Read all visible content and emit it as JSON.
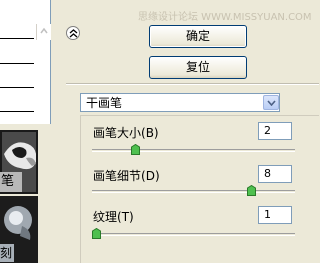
{
  "watermark": "思缘设计论坛 WWW.MISSYUAN.COM",
  "left_panel": {
    "thumb1_label": "笔",
    "thumb2_label": "刻"
  },
  "buttons": {
    "ok": "确定",
    "reset": "复位"
  },
  "filter_select": {
    "value": "干画笔"
  },
  "params": [
    {
      "label": "画笔大小",
      "hotkey": "(B)",
      "value": "2",
      "level": 0.2
    },
    {
      "label": "画笔细节",
      "hotkey": "(D)",
      "value": "8",
      "level": 0.8
    },
    {
      "label": "纹理",
      "hotkey": "(T)",
      "value": "1",
      "level": 0.0
    }
  ],
  "colors": {
    "window_bg": "#ece9d8",
    "input_border": "#7f9db9",
    "button_border": "#003c74",
    "slider_thumb": "#2e9b2e"
  },
  "icons": {
    "collapse": "chevron-double-up-icon",
    "dropdown": "chevron-down-icon",
    "slider_thumb": "slider-thumb-icon"
  }
}
